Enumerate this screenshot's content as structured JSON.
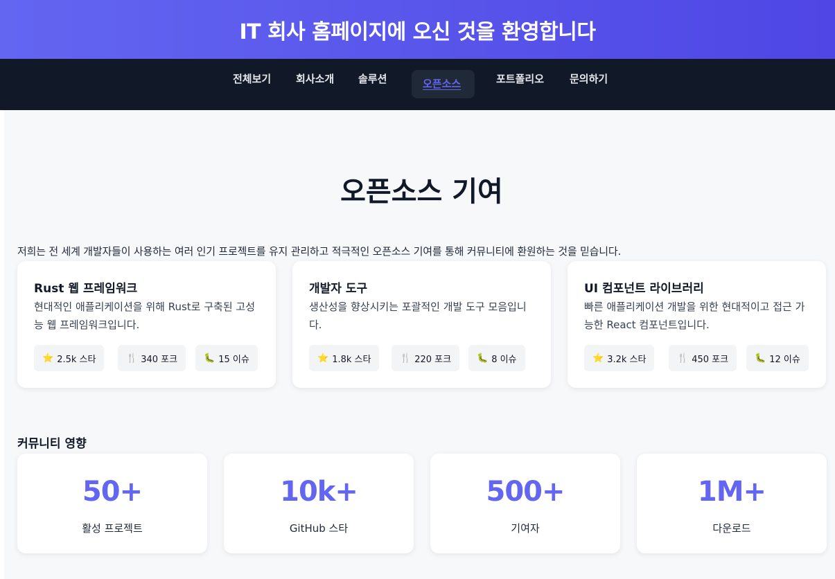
{
  "header": {
    "title": "IT 회사 홈페이지에 오신 것을 환영합니다"
  },
  "nav": {
    "items": [
      "전체보기",
      "회사소개",
      "솔루션",
      "오픈소스",
      "포트폴리오",
      "문의하기"
    ],
    "active": "오픈소스"
  },
  "main": {
    "title": "오픈소스 기여",
    "intro": "저희는 전 세계 개발자들이 사용하는 여러 인기 프로젝트를 유지 관리하고 적극적인 오픈소스 기여를 통해 커뮤니티에 환원하는 것을 믿습니다.",
    "projects": [
      {
        "title": "Rust 웹 프레임워크",
        "description": "현대적인 애플리케이션을 위해 Rust로 구축된 고성능 웹 프레임워크입니다.",
        "stars": "2.5k 스타",
        "forks": "340 포크",
        "issues": "15 이슈"
      },
      {
        "title": "개발자 도구",
        "description": "생산성을 향상시키는 포괄적인 개발 도구 모음입니다.",
        "stars": "1.8k 스타",
        "forks": "220 포크",
        "issues": "8 이슈"
      },
      {
        "title": "UI 컴포넌트 라이브러리",
        "description": "빠른 애플리케이션 개발을 위한 현대적이고 접근 가능한 React 컴포넌트입니다.",
        "stars": "3.2k 스타",
        "forks": "450 포크",
        "issues": "12 이슈"
      }
    ],
    "community": {
      "title": "커뮤니티 영향",
      "metrics": [
        {
          "value": "50+",
          "label": "활성 프로젝트"
        },
        {
          "value": "10k+",
          "label": "GitHub 스타"
        },
        {
          "value": "500+",
          "label": "기여자"
        },
        {
          "value": "1M+",
          "label": "다운로드"
        }
      ]
    }
  },
  "icons": {
    "star": "star-icon",
    "fork": "fork-icon",
    "issue": "bug-icon"
  },
  "colors": {
    "accent": "#6366f1",
    "nav_bg": "#111827",
    "hero_start": "#6366f1",
    "hero_end": "#4f46e5"
  }
}
